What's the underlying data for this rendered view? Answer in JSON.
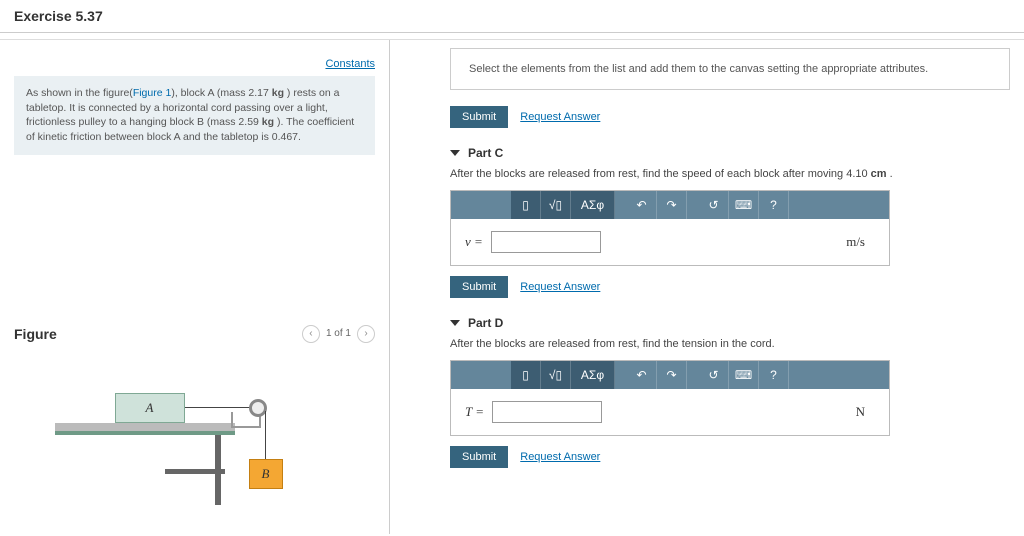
{
  "title": "Exercise 5.37",
  "links": {
    "constants": "Constants",
    "request": "Request Answer",
    "figure1": "Figure 1"
  },
  "problem": {
    "pre": "As shown in the figure(",
    "mid1": "), block A (mass 2.17 ",
    "kg": "kg",
    "mid2": " ) rests on a tabletop. It is connected by a horizontal cord passing over a light, frictionless pulley to a hanging block B (mass 2.59 ",
    "mid3": " ). The coefficient of kinetic friction between block A and the tabletop is 0.467."
  },
  "figure": {
    "heading": "Figure",
    "pager": "1 of 1",
    "labelA": "A",
    "labelB": "B"
  },
  "hint": "Select the elements from the list and add them to the canvas setting the appropriate attributes.",
  "buttons": {
    "submit": "Submit"
  },
  "partC": {
    "title": "Part C",
    "text_a": "After the blocks are released from rest, find the speed of each block after moving 4.10 ",
    "text_unit": "cm",
    "text_b": " .",
    "var": "v =",
    "unit": "m/s"
  },
  "partD": {
    "title": "Part D",
    "text": "After the blocks are released from rest, find the tension in the cord.",
    "var": "T =",
    "unit": "N"
  },
  "toolbar": {
    "templates": "▯",
    "root": "√▯",
    "greek": "ΑΣφ",
    "undo": "↶",
    "redo": "↷",
    "reset": "↺",
    "keybd": "⌨",
    "help": "?"
  }
}
